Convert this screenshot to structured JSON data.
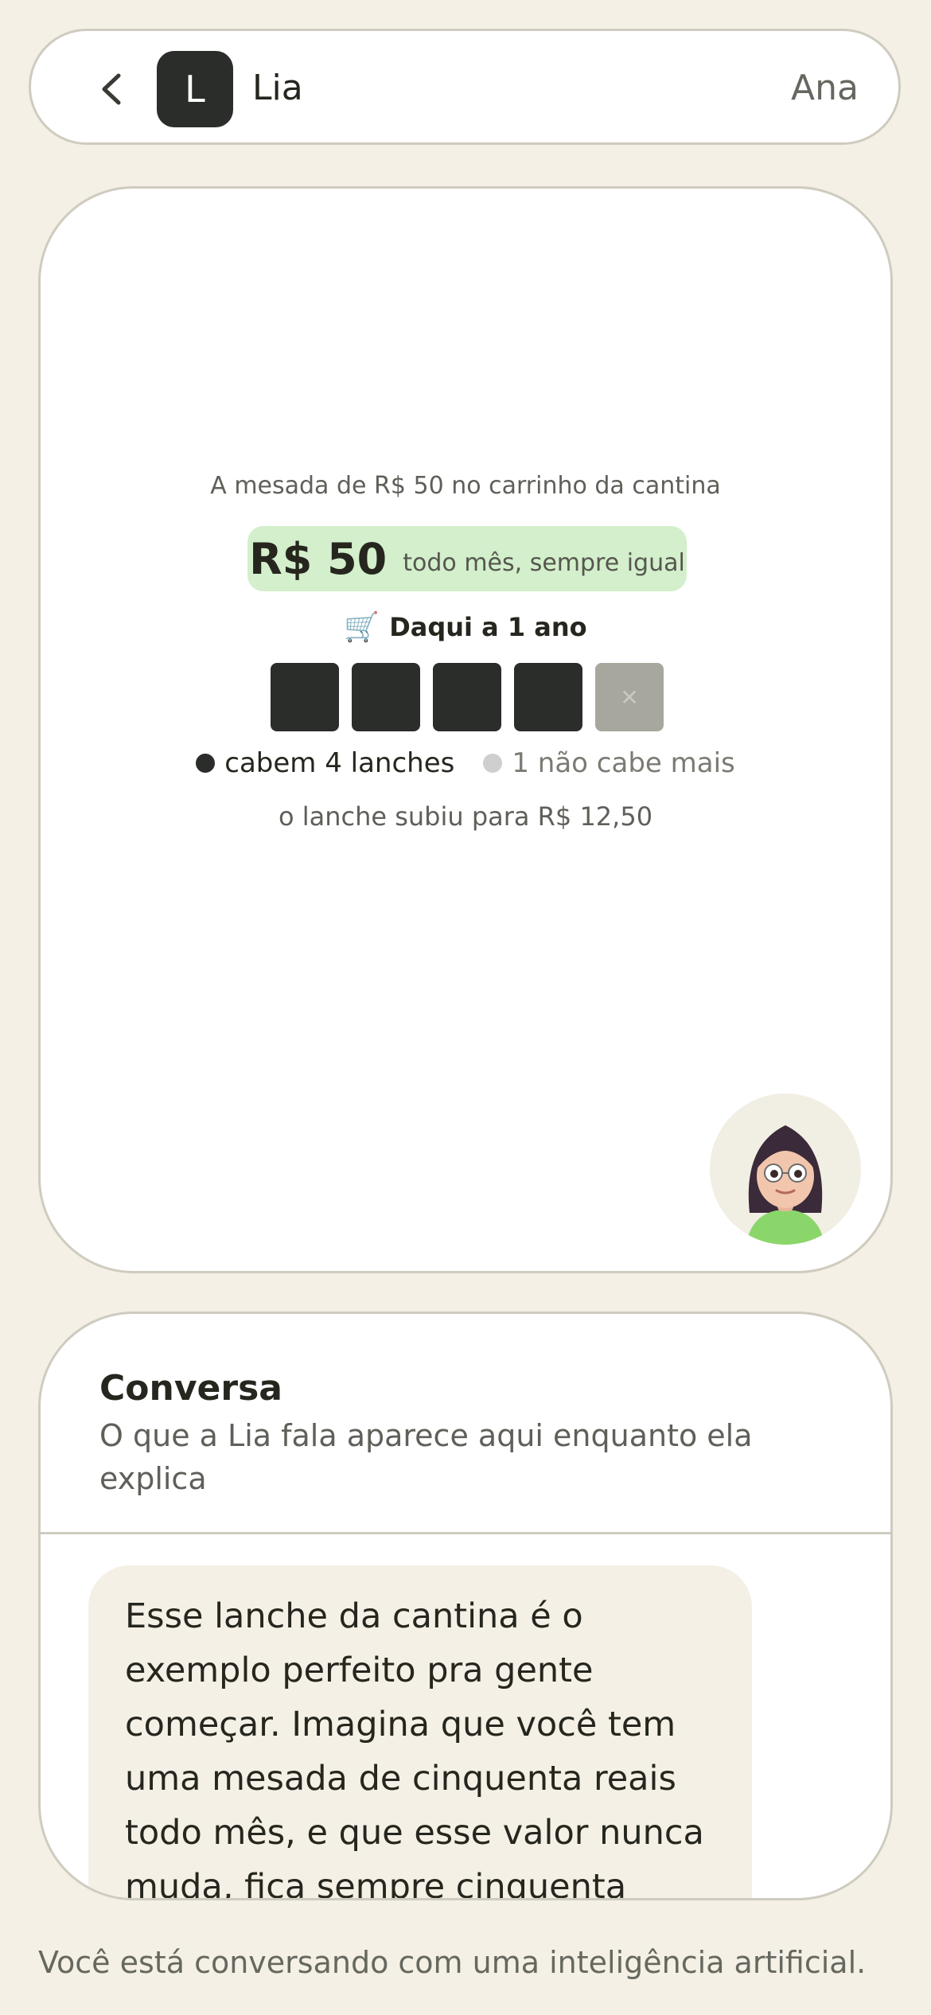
{
  "header": {
    "back_icon": "chevron-left-icon",
    "avatar_letter": "L",
    "tutor_name": "Lia",
    "user_name": "Ana"
  },
  "visual": {
    "title": "A mesada de R$ 50 no carrinho da cantina",
    "amount": "R$ 50",
    "amount_caption": "todo mês, sempre igual",
    "cart_icon": "🛒",
    "period_label": "Daqui a 1 ano",
    "boxes": {
      "total": 5,
      "filled": 4,
      "empty_mark": "✕"
    },
    "legend_fit": "cabem 4 lanches",
    "legend_nofit": "1 não cabe mais",
    "note": "o lanche subiu para R$ 12,50",
    "colors": {
      "filled": "#2b2d2a",
      "empty": "#a8a79e",
      "pill": "#d3efcb"
    }
  },
  "chat": {
    "title": "Conversa",
    "subtitle": "O que a Lia fala aparece aqui enquanto ela explica",
    "message": "Esse lanche da cantina é o exemplo perfeito pra gente começar. Imagina que você tem uma mesada de cinquenta reais todo mês, e que esse valor nunca muda, fica sempre cinquenta"
  },
  "footer": {
    "disclaimer": "Você está conversando com uma inteligência artificial."
  }
}
